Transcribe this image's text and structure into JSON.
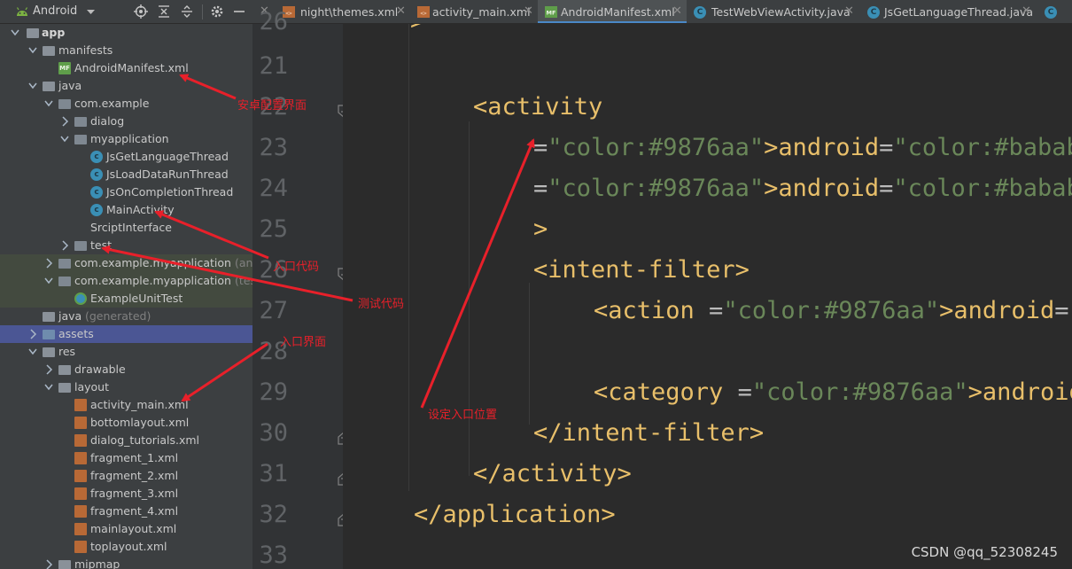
{
  "project_view": {
    "label": "Android",
    "icons": [
      "android-icon",
      "locate-icon",
      "collapse-icon",
      "expand-icon",
      "gear-icon",
      "hide-icon"
    ],
    "tree": [
      {
        "label": "app",
        "kind": "module",
        "bold": true
      },
      {
        "label": "manifests",
        "kind": "folder"
      },
      {
        "label": "AndroidManifest.xml",
        "kind": "manifest"
      },
      {
        "label": "java",
        "kind": "folder"
      },
      {
        "label": "com.example",
        "kind": "package"
      },
      {
        "label": "dialog",
        "kind": "package"
      },
      {
        "label": "myapplication",
        "kind": "package"
      },
      {
        "label": "JsGetLanguageThread",
        "kind": "class"
      },
      {
        "label": "JsLoadDataRunThread",
        "kind": "class"
      },
      {
        "label": "JsOnCompletionThread",
        "kind": "class"
      },
      {
        "label": "MainActivity",
        "kind": "class"
      },
      {
        "label": "SrciptInterface",
        "kind": "class-partial"
      },
      {
        "label": "test",
        "kind": "package"
      },
      {
        "label": "com.example.myapplication",
        "suffix": "(andro",
        "kind": "package"
      },
      {
        "label": "com.example.myapplication",
        "suffix": "(test)",
        "kind": "package"
      },
      {
        "label": "ExampleUnitTest",
        "kind": "test-class"
      },
      {
        "label": "java",
        "suffix": "(generated)",
        "kind": "folder"
      },
      {
        "label": "assets",
        "kind": "folder"
      },
      {
        "label": "res",
        "kind": "folder"
      },
      {
        "label": "drawable",
        "kind": "folder"
      },
      {
        "label": "layout",
        "kind": "folder"
      },
      {
        "label": "activity_main.xml",
        "kind": "xml"
      },
      {
        "label": "bottomlayout.xml",
        "kind": "xml"
      },
      {
        "label": "dialog_tutorials.xml",
        "kind": "xml"
      },
      {
        "label": "fragment_1.xml",
        "kind": "xml"
      },
      {
        "label": "fragment_2.xml",
        "kind": "xml"
      },
      {
        "label": "fragment_3.xml",
        "kind": "xml"
      },
      {
        "label": "fragment_4.xml",
        "kind": "xml"
      },
      {
        "label": "mainlayout.xml",
        "kind": "xml"
      },
      {
        "label": "toplayout.xml",
        "kind": "xml"
      },
      {
        "label": "mipmap",
        "kind": "folder"
      }
    ]
  },
  "tabs": [
    {
      "label": "night\\themes.xml",
      "icon": "xml-file-icon",
      "active": false
    },
    {
      "label": "activity_main.xml",
      "icon": "xml-file-icon",
      "active": false
    },
    {
      "label": "AndroidManifest.xml",
      "icon": "manifest-file-icon",
      "active": true
    },
    {
      "label": "TestWebViewActivity.java",
      "icon": "class-icon",
      "active": false
    },
    {
      "label": "JsGetLanguageThread.java",
      "icon": "class-icon",
      "active": false
    }
  ],
  "editor": {
    "lines": [
      {
        "num": "26",
        "text": ">"
      },
      {
        "num": "21",
        "text": ""
      },
      {
        "num": "22",
        "text": "<activity"
      },
      {
        "num": "23",
        "text": "android:name=\".MainActivity\""
      },
      {
        "num": "24",
        "text": "android:exported=\"true\""
      },
      {
        "num": "25",
        "text": ">"
      },
      {
        "num": "26",
        "text": "<intent-filter>"
      },
      {
        "num": "27",
        "text": "<action android:name=\"android.in"
      },
      {
        "num": "28",
        "text": ""
      },
      {
        "num": "29",
        "text": "<category android:name=\"android."
      },
      {
        "num": "30",
        "text": "</intent-filter>"
      },
      {
        "num": "31",
        "text": "</activity>"
      },
      {
        "num": "32",
        "text": "</application>"
      },
      {
        "num": "33",
        "text": ""
      }
    ]
  },
  "annotations": {
    "manifest_note": "安卓配置界面",
    "entry_code_note": "入口代码",
    "test_code_note": "测试代码",
    "entry_layout_note": "入口界面",
    "entry_position_note": "设定入口位置",
    "arrow_color": "#e8202a"
  },
  "watermark": "CSDN @qq_52308245",
  "colors": {
    "tag": "#e8bf6a",
    "namespace": "#9876aa",
    "attribute": "#bababa",
    "value": "#6a8759",
    "line_number": "#606366"
  }
}
